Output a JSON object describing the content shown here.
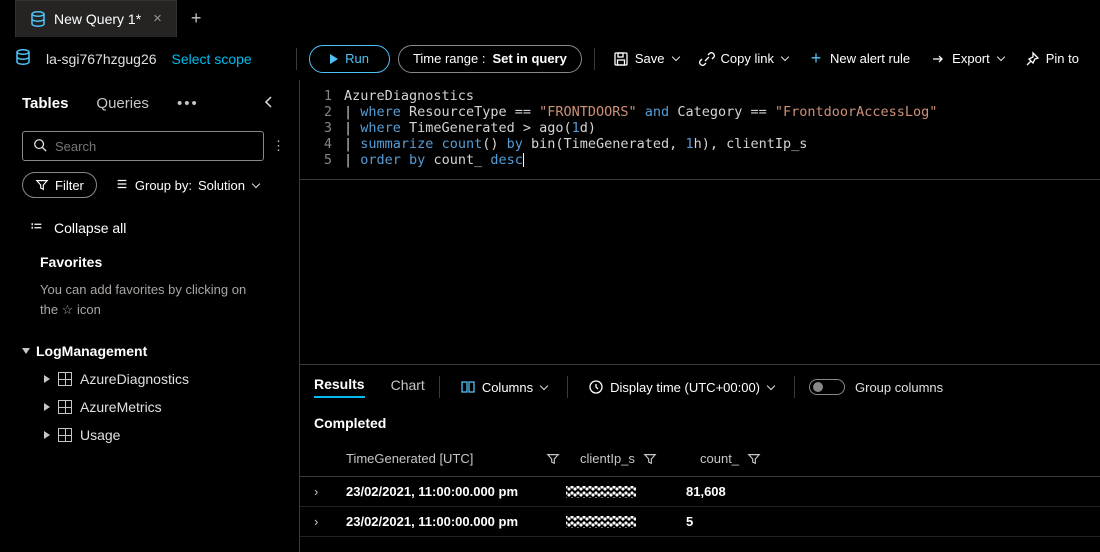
{
  "tab": {
    "title": "New Query 1*"
  },
  "scope": {
    "resource": "la-sgi767hzgug26",
    "select_scope": "Select scope"
  },
  "toolbar": {
    "run": "Run",
    "time_range_label": "Time range :",
    "time_range_value": "Set in query",
    "save": "Save",
    "copy_link": "Copy link",
    "new_alert": "New alert rule",
    "export": "Export",
    "pin": "Pin to"
  },
  "sidebar": {
    "tabs": {
      "tables": "Tables",
      "queries": "Queries"
    },
    "search_placeholder": "Search",
    "filter": "Filter",
    "groupby_label": "Group by:",
    "groupby_value": "Solution",
    "collapse_all": "Collapse all",
    "favorites_header": "Favorites",
    "favorites_body": "You can add favorites by clicking on the ☆ icon",
    "logmgmt": "LogManagement",
    "items": [
      {
        "label": "AzureDiagnostics"
      },
      {
        "label": "AzureMetrics"
      },
      {
        "label": "Usage"
      }
    ]
  },
  "editor": {
    "lines": [
      "1",
      "2",
      "3",
      "4",
      "5"
    ],
    "code": {
      "l1": "AzureDiagnostics",
      "l2a": "where",
      "l2b": "ResourceType ==",
      "l2c": "\"FRONTDOORS\"",
      "l2d": "and",
      "l2e": "Category ==",
      "l2f": "\"FrontdoorAccessLog\"",
      "l3a": "where",
      "l3b": "TimeGenerated > ago(",
      "l3c": "1",
      "l3d": "d)",
      "l4a": "summarize",
      "l4b": "count",
      "l4c": "()",
      "l4d": "by",
      "l4e": "bin(TimeGenerated,",
      "l4f": "1",
      "l4g": "h), clientIp_s",
      "l5a": "order by",
      "l5b": "count_",
      "l5c": "desc"
    }
  },
  "results": {
    "tabs": {
      "results": "Results",
      "chart": "Chart"
    },
    "columns_btn": "Columns",
    "display_time": "Display time (UTC+00:00)",
    "group_columns": "Group columns",
    "status": "Completed",
    "headers": {
      "time": "TimeGenerated [UTC]",
      "ip": "clientIp_s",
      "count": "count_"
    },
    "rows": [
      {
        "time": "23/02/2021, 11:00:00.000 pm",
        "count": "81,608"
      },
      {
        "time": "23/02/2021, 11:00:00.000 pm",
        "count": "5"
      }
    ]
  }
}
